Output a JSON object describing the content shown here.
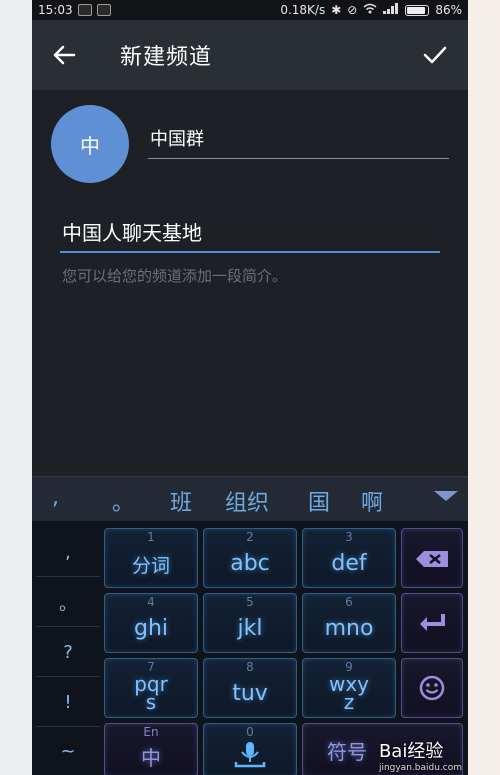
{
  "status": {
    "time": "15:03",
    "net_speed": "0.18K/s",
    "battery": "86%",
    "battery_level": 0.86
  },
  "toolbar": {
    "title": "新建频道"
  },
  "form": {
    "avatar_letter": "中",
    "channel_name": "中国群",
    "description": "中国人聊天基地",
    "description_hint": "您可以给您的频道添加一段简介。"
  },
  "candidates": [
    ",",
    "。",
    "班",
    "组织",
    "国",
    "啊"
  ],
  "keyboard": {
    "side_keys": [
      ",",
      "。",
      "?",
      "!",
      "~"
    ],
    "rows": [
      [
        {
          "num": "1",
          "label": "分词"
        },
        {
          "num": "2",
          "label": "abc"
        },
        {
          "num": "3",
          "label": "def"
        }
      ],
      [
        {
          "num": "4",
          "label": "ghi"
        },
        {
          "num": "5",
          "label": "jkl"
        },
        {
          "num": "6",
          "label": "mno"
        }
      ],
      [
        {
          "num": "7",
          "label": "pqr\ns"
        },
        {
          "num": "8",
          "label": "tuv"
        },
        {
          "num": "9",
          "label": "wxy\nz"
        }
      ]
    ],
    "lang_top": "En",
    "lang_main": "中",
    "space_num": "0",
    "symbols_label": "符号"
  },
  "watermark": {
    "text": "Bai经验",
    "url": "jingyan.baidu.com"
  },
  "colors": {
    "accent": "#4e8fd8",
    "avatar": "#5f8fd4",
    "toolbar": "#2a2f35",
    "background": "#1d2126"
  },
  "icons": {
    "back": "arrow-left-icon",
    "done": "check-icon",
    "backspace": "backspace-icon",
    "enter": "enter-icon",
    "emoji": "smiley-icon",
    "mic": "microphone-icon"
  }
}
